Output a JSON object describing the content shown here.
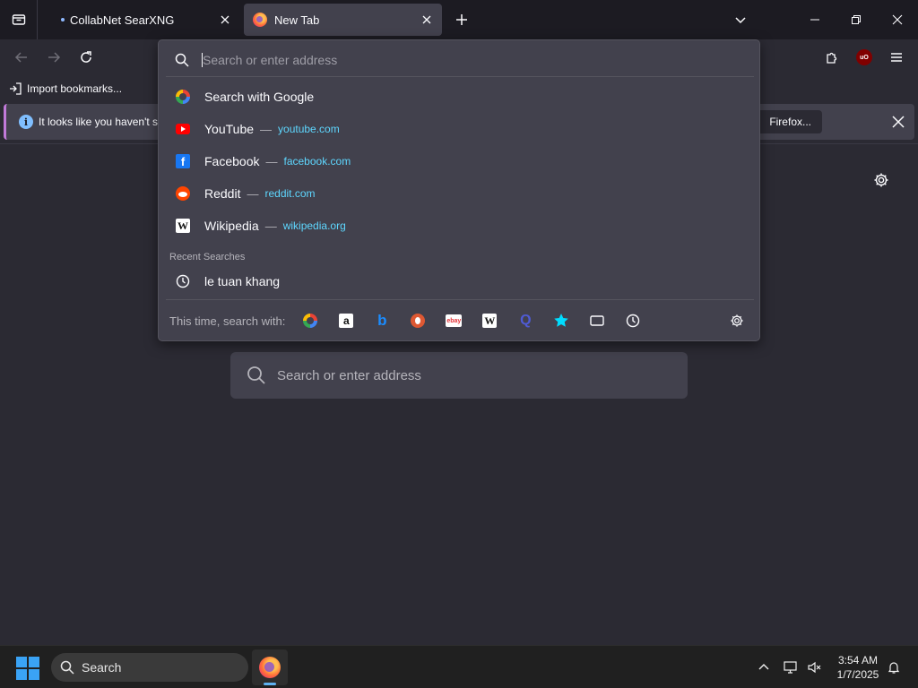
{
  "tabs": [
    {
      "label": "CollabNet SearXNG",
      "active": false
    },
    {
      "label": "New Tab",
      "active": true
    }
  ],
  "bookmarks": {
    "import_label": "Import bookmarks..."
  },
  "notification": {
    "text": "It looks like you haven't st",
    "action_label": "Firefox..."
  },
  "urlbar": {
    "placeholder": "Search or enter address",
    "search_with_label": "Search with Google",
    "suggestions": [
      {
        "title": "YouTube",
        "url": "youtube.com",
        "icon": "youtube-icon"
      },
      {
        "title": "Facebook",
        "url": "facebook.com",
        "icon": "facebook-icon"
      },
      {
        "title": "Reddit",
        "url": "reddit.com",
        "icon": "reddit-icon"
      },
      {
        "title": "Wikipedia",
        "url": "wikipedia.org",
        "icon": "wikipedia-icon"
      }
    ],
    "separator": "—",
    "recent_header": "Recent Searches",
    "recent": [
      {
        "text": "le tuan khang"
      }
    ],
    "engines_label": "This time, search with:",
    "engines": [
      "google-icon",
      "amazon-icon",
      "bing-icon",
      "duckduckgo-icon",
      "ebay-icon",
      "wikipedia-icon",
      "perplexity-icon",
      "bookmarks-icon",
      "tabs-icon",
      "history-icon"
    ]
  },
  "page": {
    "search_placeholder": "Search or enter address"
  },
  "taskbar": {
    "search_label": "Search",
    "time": "3:54 AM",
    "date": "1/7/2025"
  },
  "colors": {
    "accent_link": "#5ed7ff",
    "chrome_bg": "#1c1b22",
    "popup_bg": "#42414d",
    "notif_border": "#c17ad9"
  }
}
